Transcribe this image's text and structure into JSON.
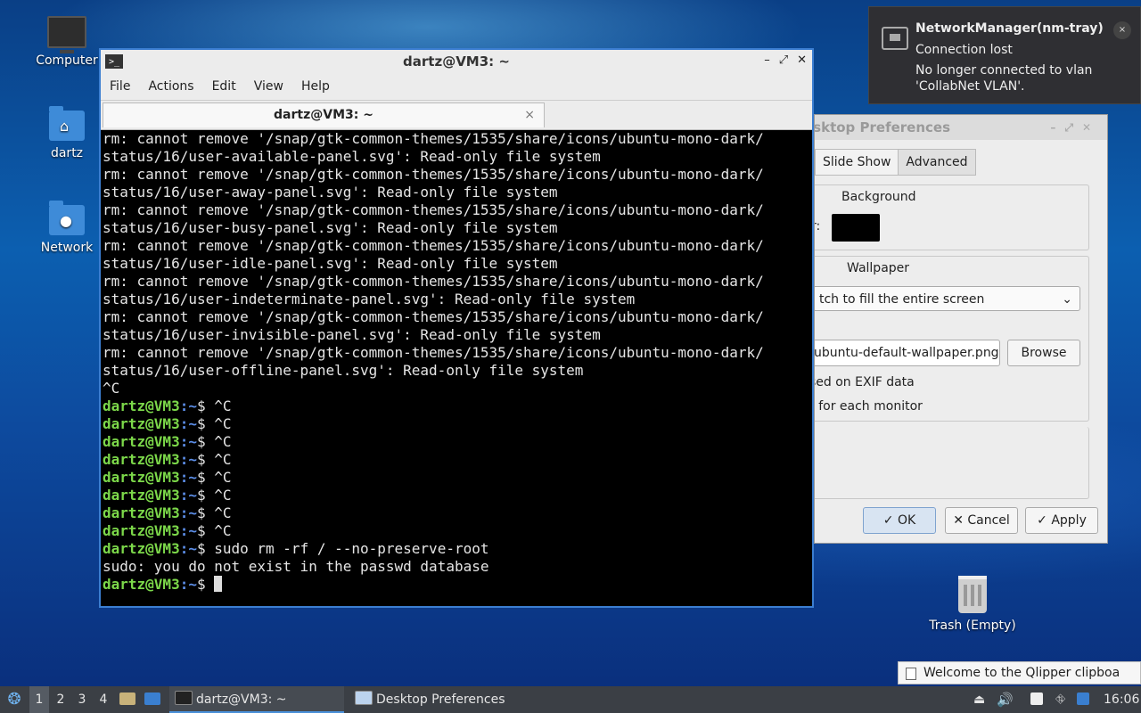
{
  "desktop": {
    "icons": [
      {
        "label": "Computer",
        "icon": "computer-icon"
      },
      {
        "label": "dartz",
        "icon": "home-folder-icon"
      },
      {
        "label": "Network",
        "icon": "network-folder-icon"
      },
      {
        "label": "Trash (Empty)",
        "icon": "trash-icon"
      }
    ]
  },
  "terminal": {
    "title": "dartz@VM3: ~",
    "menu": [
      "File",
      "Actions",
      "Edit",
      "View",
      "Help"
    ],
    "tab_label": "dartz@VM3: ~",
    "tab_close": "×",
    "controls": [
      "–",
      "⤢",
      "✕"
    ],
    "lines": [
      "rm: cannot remove '/snap/gtk-common-themes/1535/share/icons/ubuntu-mono-dark/",
      "status/16/user-available-panel.svg': Read-only file system",
      "rm: cannot remove '/snap/gtk-common-themes/1535/share/icons/ubuntu-mono-dark/",
      "status/16/user-away-panel.svg': Read-only file system",
      "rm: cannot remove '/snap/gtk-common-themes/1535/share/icons/ubuntu-mono-dark/",
      "status/16/user-busy-panel.svg': Read-only file system",
      "rm: cannot remove '/snap/gtk-common-themes/1535/share/icons/ubuntu-mono-dark/",
      "status/16/user-idle-panel.svg': Read-only file system",
      "rm: cannot remove '/snap/gtk-common-themes/1535/share/icons/ubuntu-mono-dark/",
      "status/16/user-indeterminate-panel.svg': Read-only file system",
      "rm: cannot remove '/snap/gtk-common-themes/1535/share/icons/ubuntu-mono-dark/",
      "status/16/user-invisible-panel.svg': Read-only file system",
      "rm: cannot remove '/snap/gtk-common-themes/1535/share/icons/ubuntu-mono-dark/",
      "status/16/user-offline-panel.svg': Read-only file system",
      "^C"
    ],
    "prompt_user": "dartz@VM3",
    "prompt_path": ":~",
    "prompt_sign": "$ ",
    "prompt_entries": [
      "^C",
      "^C",
      "^C",
      "^C",
      "^C",
      "^C",
      "^C",
      "^C",
      "sudo rm -rf / --no-preserve-root"
    ],
    "final_output": "sudo: you do not exist in the passwd database"
  },
  "prefs": {
    "title": "Desktop Preferences",
    "title_visible": "esktop Preferences",
    "tabs": [
      "Slide Show",
      "Advanced"
    ],
    "background_group": "Background",
    "color_label": "r:",
    "wallpaper_group": "Wallpaper",
    "mode_value": "tch to fill the entire screen",
    "path_value": "ubuntu-default-wallpaper.png",
    "browse_label": "Browse",
    "exif_label": "sed on EXIF data",
    "monitor_label": "r for each monitor",
    "ok_label": "OK",
    "cancel_label": "Cancel",
    "apply_label": "Apply",
    "colors": {
      "swatch": "#000000"
    }
  },
  "notification": {
    "title": "NetworkManager(nm-tray)",
    "summary": "Connection lost",
    "body": "No longer connected to vlan 'CollabNet VLAN'.",
    "close": "×"
  },
  "tooltip": {
    "text": "Welcome to the Qlipper clipboa"
  },
  "taskbar": {
    "workspaces": [
      "1",
      "2",
      "3",
      "4"
    ],
    "tasks": [
      "dartz@VM3: ~",
      "Desktop Preferences"
    ],
    "clock": "16:06"
  }
}
